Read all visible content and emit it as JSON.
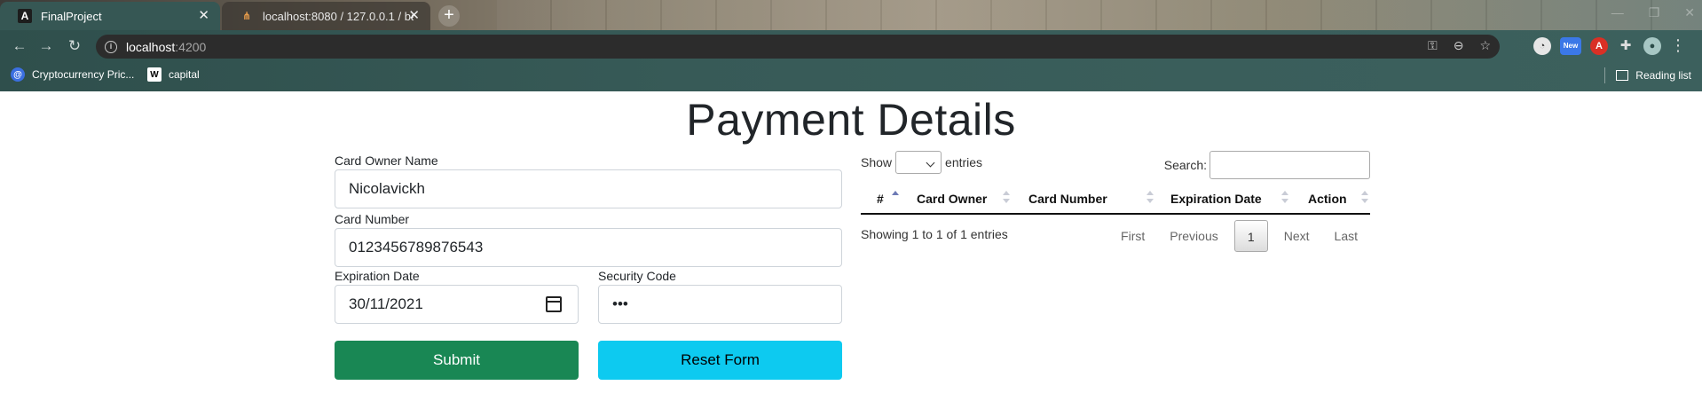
{
  "browser": {
    "tabs": [
      {
        "title": "FinalProject",
        "active": true
      },
      {
        "title": "localhost:8080 / 127.0.0.1 / banl",
        "active": false
      }
    ],
    "url_host": "localhost",
    "url_port": ":4200",
    "bookmarks": [
      {
        "label": "Cryptocurrency Pric...",
        "icon": "coin-icon"
      },
      {
        "label": "capital",
        "icon": "wikipedia-icon"
      }
    ],
    "reading_list": "Reading list",
    "extension_badge": "New"
  },
  "page": {
    "title": "Payment Details"
  },
  "form": {
    "owner_label": "Card Owner Name",
    "owner_value": "Nicolavickh",
    "number_label": "Card Number",
    "number_value": "0123456789876543",
    "expiry_label": "Expiration Date",
    "expiry_value": "30/11/2021",
    "security_label": "Security Code",
    "security_value": "•••",
    "submit_label": "Submit",
    "reset_label": "Reset Form"
  },
  "table": {
    "show_label": "Show",
    "entries_label": "entries",
    "search_label": "Search:",
    "columns": [
      "#",
      "Card Owner",
      "Card Number",
      "Expiration Date",
      "Action"
    ],
    "info": "Showing 1 to 1 of 1 entries",
    "pager": {
      "first": "First",
      "previous": "Previous",
      "current": "1",
      "next": "Next",
      "last": "Last"
    }
  },
  "colors": {
    "submit": "#198754",
    "reset": "#0dcaf0",
    "chrome": "#365754"
  }
}
